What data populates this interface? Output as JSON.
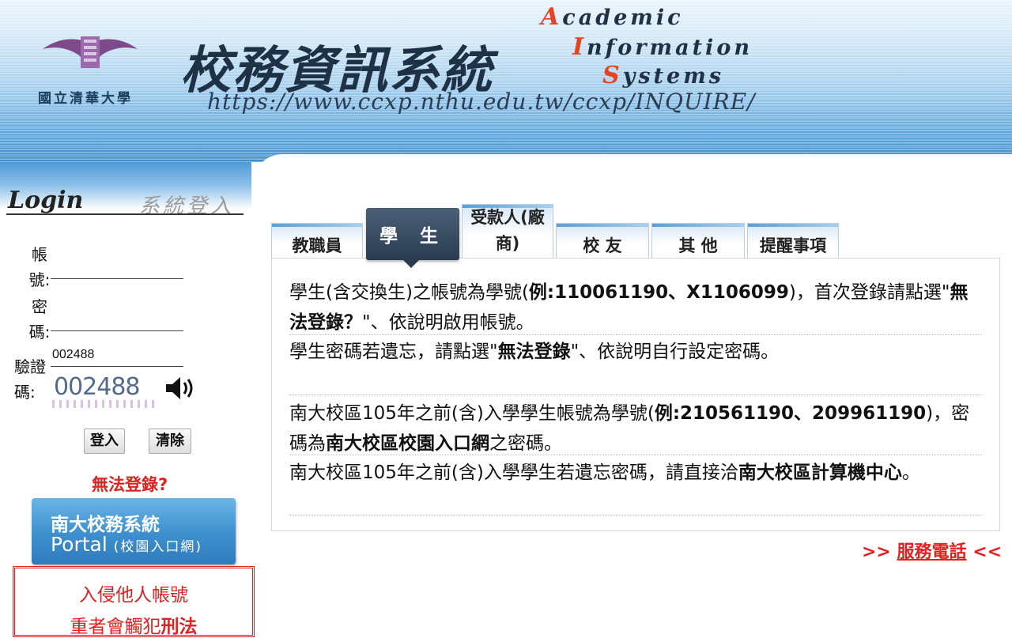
{
  "header": {
    "university_name": "國立清華大學",
    "system_title": "校務資訊系統",
    "url": "https://www.ccxp.nthu.edu.tw/ccxp/INQUIRE/",
    "english": {
      "line1_initial": "A",
      "line1_rest": "cademic",
      "line2_initial": "I",
      "line2_rest": "nformation",
      "line3_initial": "S",
      "line3_rest": "ystems"
    },
    "accent_color": "#e8421f"
  },
  "login": {
    "title_en": "Login",
    "title_zh": "系統登入",
    "account_label": "帳號:",
    "account_value": "",
    "password_label": "密碼:",
    "password_value": "",
    "captcha_label": "驗證碼:",
    "captcha_value": "002488",
    "captcha_image_text": "002488",
    "speaker_icon": "speaker-icon",
    "login_button": "登入",
    "clear_button": "清除",
    "cannot_login": "無法登錄?"
  },
  "portal": {
    "line1": "南大校務系統",
    "line2": "Portal",
    "line2_sub": "(校園入口網)"
  },
  "warning": {
    "line1": "入侵他人帳號",
    "line2_prefix": "重者會觸犯",
    "line2_bold": "刑法"
  },
  "tabs": {
    "staff": "教職員",
    "student": "學 生",
    "vendor_line1": "受款人(廠",
    "vendor_line2": "商)",
    "alumni": "校 友",
    "other": "其 他",
    "reminder": "提醒事項",
    "active": "student"
  },
  "content": {
    "p1_a": "學生(含交換生)之帳號為學號(",
    "p1_b": "例:110061190、X1106099",
    "p1_c": ")，首次登錄請點選\"",
    "p1_d": "無法登錄？",
    "p1_e": "\"、依說明啟用帳號。",
    "p2_a": "學生密碼若遺忘，請點選\"",
    "p2_b": "無法登錄",
    "p2_c": "\"、依說明自行設定密碼。",
    "p3_a": "南大校區105年之前(含)入學學生帳號為學號(",
    "p3_b": "例:210561190、209961190",
    "p3_c": ")，密碼為",
    "p3_d": "南大校區校園入口網",
    "p3_e": "之密碼。",
    "p4_a": "南大校區105年之前(含)入學學生若遺忘密碼，請直接洽",
    "p4_b": "南大校區計算機中心",
    "p4_c": "。"
  },
  "service_phone": {
    "prefix": ">> ",
    "link": "服務電話",
    "suffix": " <<"
  },
  "colors": {
    "warning_red": "#e22020",
    "active_tab": "#2b3c50",
    "portal_blue": "#3d8fcd"
  }
}
